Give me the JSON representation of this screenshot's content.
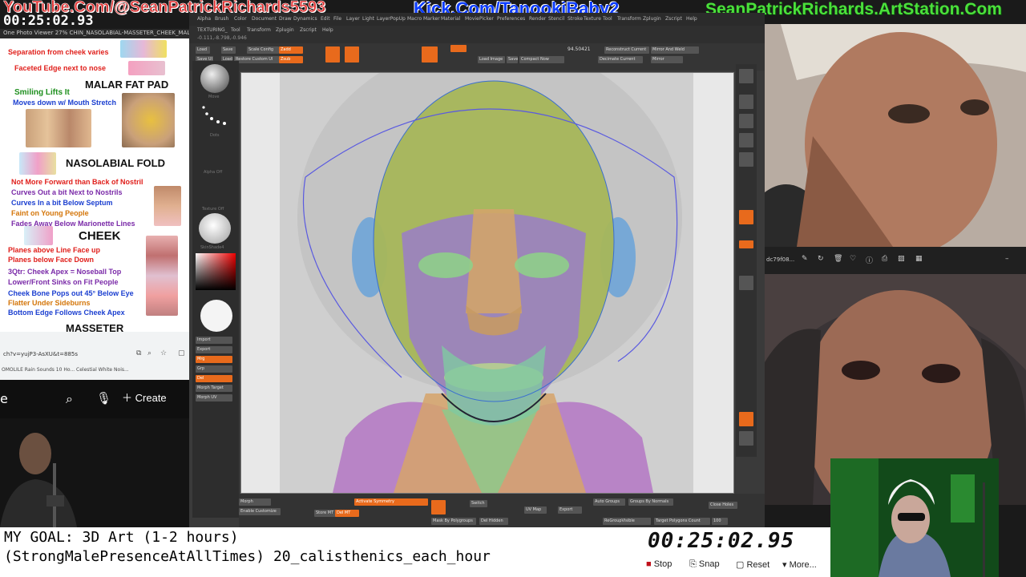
{
  "overlay": {
    "youtube": "YouTube.Com/@SeanPatrickRichards5593",
    "timer_top": "00:25:02.93",
    "kick": "Kick.Com/TanookiBaby2",
    "artstation": "SeanPatrickRichards.ArtStation.Com"
  },
  "reference_sheet": {
    "viewer_title": "One Photo Viewer  27%  CHIN_NASOLABIAL-MASSETER_CHEEK_MALAR.tif",
    "lines": {
      "l1": "Separation from cheek varies",
      "l2": "Faceted Edge next to nose",
      "h1": "MALAR FAT PAD",
      "l3": "Smiling Lifts It",
      "l4": "Moves down w/ Mouth Stretch",
      "h2": "NASOLABIAL FOLD",
      "l5": "Not More Forward than Back of Nostril",
      "l6": "Curves Out a bit Next to Nostrils",
      "l7": "Curves In a bit Below Septum",
      "l8": "Faint on Young People",
      "l9": "Fades Away Below Marionette Lines",
      "h3": "CHEEK",
      "l10": "Planes above Line Face up",
      "l11": "Planes below Face Down",
      "l12": "3Qtr: Cheek Apex = Noseball Top",
      "l13": "Lower/Front Sinks on Fit People",
      "l14": "Cheek Bone Pops out 45° Below Eye",
      "l15": "Flatter Under Sideburns",
      "l16": "Bottom Edge Follows Cheek Apex",
      "h4": "MASSETER"
    }
  },
  "browser": {
    "url": "ch?v=yujP3-AsXU&t=885s",
    "tabs": "OMOLILE   Rain Sounds 10 Ho...   Celestial White Nois..."
  },
  "youtube_strip": {
    "edge_letter": "e",
    "create_label": "Create"
  },
  "zbrush": {
    "menus": [
      "Alpha",
      "Brush",
      "Color",
      "Document",
      "Draw",
      "Dynamics",
      "Edit",
      "File",
      "Layer",
      "Light",
      "LayerPopUp",
      "Macro",
      "Marker",
      "Material",
      "Movie",
      "Picker",
      "Preferences",
      "Render",
      "Stencil",
      "Stroke",
      "Texture",
      "Tool",
      "Transform",
      "Zplugin",
      "Zscript",
      "Help"
    ],
    "submenu": [
      "TEXTURING_",
      "Tool",
      "Transform",
      "Zplugin",
      "Zscript",
      "Help"
    ],
    "coords": "-0.111,-8.798,-0.946",
    "value": "94.50421",
    "shelf_buttons": [
      "Load",
      "Save",
      "Scale Config",
      "Zadd",
      "Save UI",
      "Load",
      "Restore Custom UI",
      "Zsub",
      "Load Image",
      "Save V",
      "Compact Now",
      "Decimate Current",
      "Reconstruct Current",
      "Mirror And Weld",
      "Mirror"
    ],
    "left_tray": [
      "Move",
      "Dots",
      "Alpha Off",
      "Texture Off",
      "SkinShade4",
      "Import",
      "Export",
      "Mrg",
      "Grp",
      "Del",
      "Morph Target",
      "Morph UV"
    ],
    "bottom_buttons": [
      "Morph",
      "Enable Customize",
      "Activate Symmetry",
      "Store MT",
      "Del MT",
      "Switch",
      "UV Map",
      "Mask By Polygroups",
      "Del Hidden",
      "Auto Groups",
      "Groups By Normals",
      "ReGroupVisible",
      "Close Holes",
      "Export",
      "Target Polygons Count",
      "100"
    ]
  },
  "photo_bar": {
    "label": "dc79f08..."
  },
  "goal": {
    "line1": "MY GOAL: 3D Art (1-2 hours)",
    "line2": "(StrongMalePresenceAtAllTimes) 20_calisthenics_each_hour"
  },
  "stopwatch": {
    "time": "00:25:02.95",
    "stop": "Stop",
    "snap": "Snap",
    "reset": "Reset",
    "more": "More..."
  },
  "colors": {
    "kick_blue": "#0c3cff",
    "youtube_red": "#e23b3b",
    "artstation_green": "#4be03b",
    "zbrush_orange": "#e86a1c"
  }
}
